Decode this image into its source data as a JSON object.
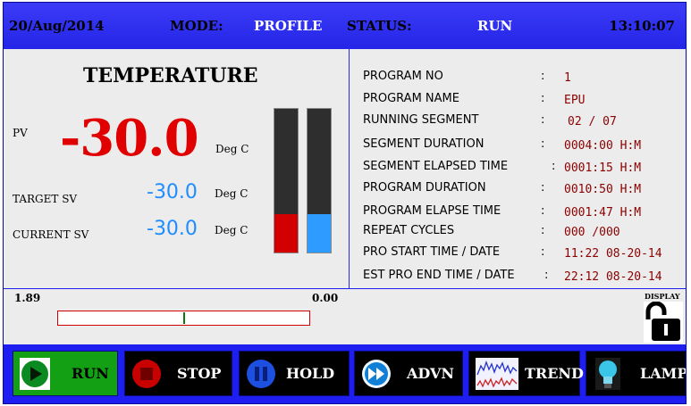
{
  "header": {
    "date": "20/Aug/2014",
    "mode_label": "MODE:",
    "mode": "PROFILE",
    "status_label": "STATUS:",
    "status": "RUN",
    "time": "13:10:07"
  },
  "temperature": {
    "title": "TEMPERATURE",
    "pv_label": "PV",
    "pv_value": "-30.0",
    "unit": "Deg C",
    "target_sv_label": "TARGET SV",
    "target_sv_value": "-30.0",
    "current_sv_label": "CURRENT SV",
    "current_sv_value": "-30.0",
    "pv_bar_fraction": 0.27,
    "sv_bar_fraction": 0.27
  },
  "program": {
    "rows": [
      {
        "key": "PROGRAM NO",
        "colon": ":",
        "value": "1"
      },
      {
        "key": "PROGRAM NAME",
        "colon": ":",
        "value": "EPU"
      },
      {
        "key": "RUNNING SEGMENT",
        "colon": ":",
        "value": "02 / 07"
      },
      {
        "key": "SEGMENT DURATION",
        "colon": ":",
        "value": "0004:00 H:M"
      },
      {
        "key": "SEGMENT ELAPSED TIME",
        "colon": ":",
        "value": "0001:15 H:M"
      },
      {
        "key": "PROGRAM DURATION",
        "colon": ":",
        "value": "0010:50 H:M"
      },
      {
        "key": "PROGRAM ELAPSE TIME",
        "colon": ":",
        "value": "0001:47 H:M"
      },
      {
        "key": "REPEAT CYCLES",
        "colon": ":",
        "value": "000 /000"
      },
      {
        "key": "PRO START TIME / DATE",
        "colon": ":",
        "value": "11:22 08-20-14"
      },
      {
        "key": "EST PRO END TIME / DATE",
        "colon": ":",
        "value": "22:12 08-20-14"
      }
    ]
  },
  "progress": {
    "left_value": "1.89",
    "right_value": "0.00",
    "marker_fraction": 0.5
  },
  "display": {
    "label": "DISPLAY",
    "icon": "unlocked-padlock-icon"
  },
  "buttons": {
    "run": "RUN",
    "stop": "STOP",
    "hold": "HOLD",
    "advn": "ADVN",
    "trend": "TREND",
    "lamp": "LAMP"
  },
  "colors": {
    "screen_bg": "#1e1ef0",
    "panel_bg": "#ececec",
    "pv_red": "#e00000",
    "sv_blue": "#1f8cff",
    "value_darkred": "#8b0000",
    "run_green": "#14a014"
  }
}
